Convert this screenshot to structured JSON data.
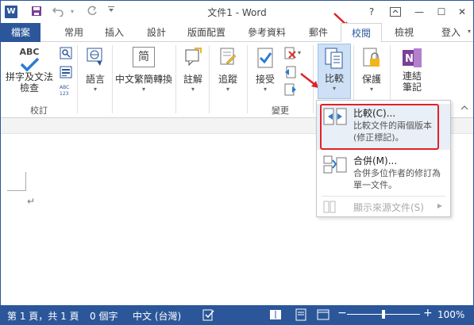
{
  "title_bar": {
    "app_icon": "W",
    "title": "文件1 - Word",
    "help": "?",
    "minimize": "—",
    "maximize": "☐",
    "close": "✕"
  },
  "tabs": {
    "file": "檔案",
    "items": [
      "常用",
      "插入",
      "設計",
      "版面配置",
      "參考資料",
      "郵件",
      "校閱",
      "檢視"
    ],
    "active": "校閱",
    "sign_in": "登入"
  },
  "ribbon": {
    "proofing": {
      "abc": "ABC",
      "spelling_line1": "拼字及文法",
      "spelling_line2": "檢查",
      "group_label": "校訂"
    },
    "language": {
      "label": "語言"
    },
    "chinese_conversion": {
      "label": "中文繁簡轉換",
      "glyph": "简"
    },
    "comments": {
      "label": "註解"
    },
    "tracking": {
      "label": "追蹤"
    },
    "changes": {
      "accept": "接受",
      "group_label": "變更"
    },
    "compare": {
      "label": "比較"
    },
    "protect": {
      "label": "保護"
    },
    "onenote": {
      "line1": "連結",
      "line2": "筆記"
    }
  },
  "compare_menu": {
    "compare_title": "比較(C)...",
    "compare_desc": "比較文件的兩個版本 (修正標記)。",
    "combine_title": "合併(M)...",
    "combine_desc": "合併多位作者的修訂為單一文件。",
    "show_source": "顯示來源文件(S)"
  },
  "status_bar": {
    "page": "第 1 頁，共 1 頁",
    "words": "0 個字",
    "language": "中文 (台灣)",
    "zoom_minus": "−",
    "zoom_plus": "+",
    "zoom": "100%"
  },
  "colors": {
    "accent": "#2b579a",
    "highlight": "#e32029"
  },
  "document": {
    "paragraph_mark": "↵"
  }
}
